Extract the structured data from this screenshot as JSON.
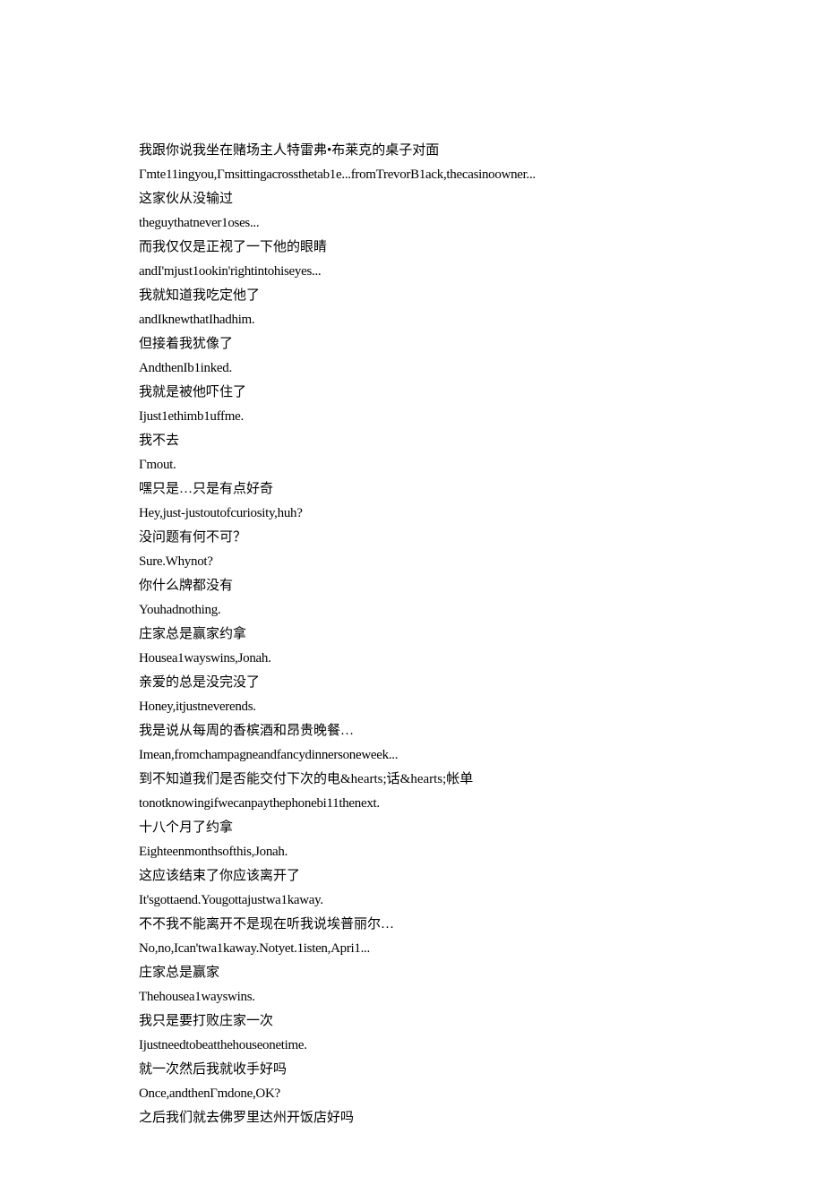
{
  "lines": [
    "我跟你说我坐在赌场主人特雷弗•布莱克的桌子对面",
    "Γmte11ingyou,Γmsittingacrossthetab1e...fromTrevorB1ack,thecasinoowner...",
    "这家伙从没输过",
    "theguythatnever1oses...",
    "而我仅仅是正视了一下他的眼睛",
    "andI'mjust1ookin'rightintohiseyes...",
    "我就知道我吃定他了",
    "andIknewthatIhadhim.",
    "但接着我犹像了",
    "AndthenIb1inked.",
    "我就是被他吓住了",
    "Ijust1ethimb1uffme.",
    "我不去",
    "Γmout.",
    "嘿只是…只是有点好奇",
    "Hey,just-justoutofcuriosity,huh?",
    "没问题有何不可？",
    "Sure.Whynot?",
    "你什么牌都没有",
    "Youhadnothing.",
    "庄家总是赢家约拿",
    "Housea1wayswins,Jonah.",
    "亲爱的总是没完没了",
    "Honey,itjustneverends.",
    "我是说从每周的香槟酒和昂贵晚餐…",
    "Imean,fromchampagneandfancydinnersoneweek...",
    "到不知道我们是否能交付下次的电&hearts;话&hearts;帐单",
    "tonotknowingifwecanpaythephonebi11thenext.",
    "十八个月了约拿",
    "Eighteenmonthsofthis,Jonah.",
    "这应该结束了你应该离开了",
    "It'sgottaend.Yougottajustwa1kaway.",
    "不不我不能离开不是现在听我说埃普丽尔…",
    "No,no,Ican'twa1kaway.Notyet.1isten,Apri1...",
    "庄家总是赢家",
    "Thehousea1wayswins.",
    "我只是要打败庄家一次",
    "Ijustneedtobeatthehouseonetime.",
    "就一次然后我就收手好吗",
    "Once,andthenΓmdone,OK?",
    "之后我们就去佛罗里达州开饭店好吗"
  ]
}
